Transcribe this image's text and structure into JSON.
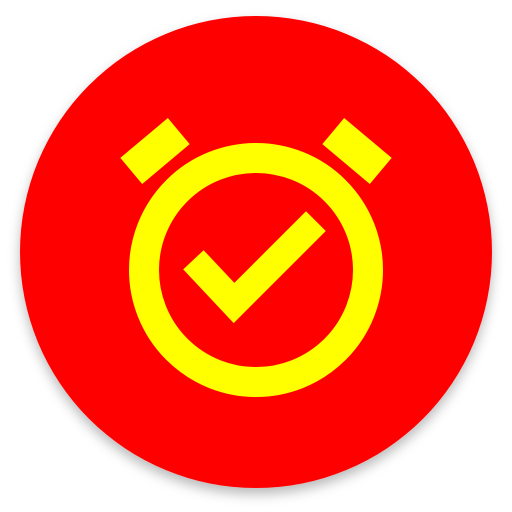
{
  "icon": {
    "name": "alarm-check-icon",
    "background_color": "#ff0000",
    "glyph_color": "#ffff00"
  }
}
